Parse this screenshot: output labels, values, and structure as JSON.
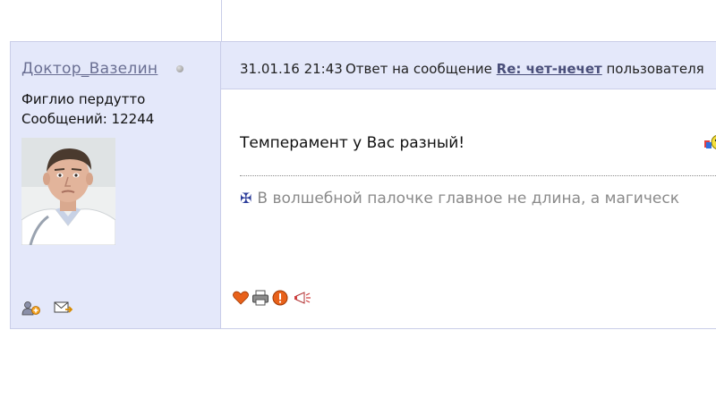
{
  "post": {
    "author": {
      "name": "Доктор_Вазелин",
      "title": "Фиглио пердутто",
      "posts_label": "Сообщений: 12244",
      "status": "offline"
    },
    "header": {
      "date": "31.01.16 21:43",
      "reply_prefix": "Ответ на сообщение",
      "topic_link": "Re: чет-нечет",
      "reply_suffix": "пользователя"
    },
    "message": "Темперамент у Вас разный!",
    "signature": "В волшебной палочке главное не длина, а магическ"
  },
  "icons": {
    "add_friend": "add-user-icon",
    "send_message": "envelope-icon",
    "like": "heart-icon",
    "print": "printer-icon",
    "report": "warning-icon",
    "shout": "megaphone-icon",
    "smiley": "christmas-tree-smiley-icon",
    "online": "status-dot-icon",
    "signature_mark": "cross-icon"
  },
  "colors": {
    "panel_bg": "#e4e8fa",
    "border": "#c9cde8",
    "author_link": "#6a6f93",
    "topic_link": "#4a4f7a",
    "signature": "#8a8a8a"
  }
}
